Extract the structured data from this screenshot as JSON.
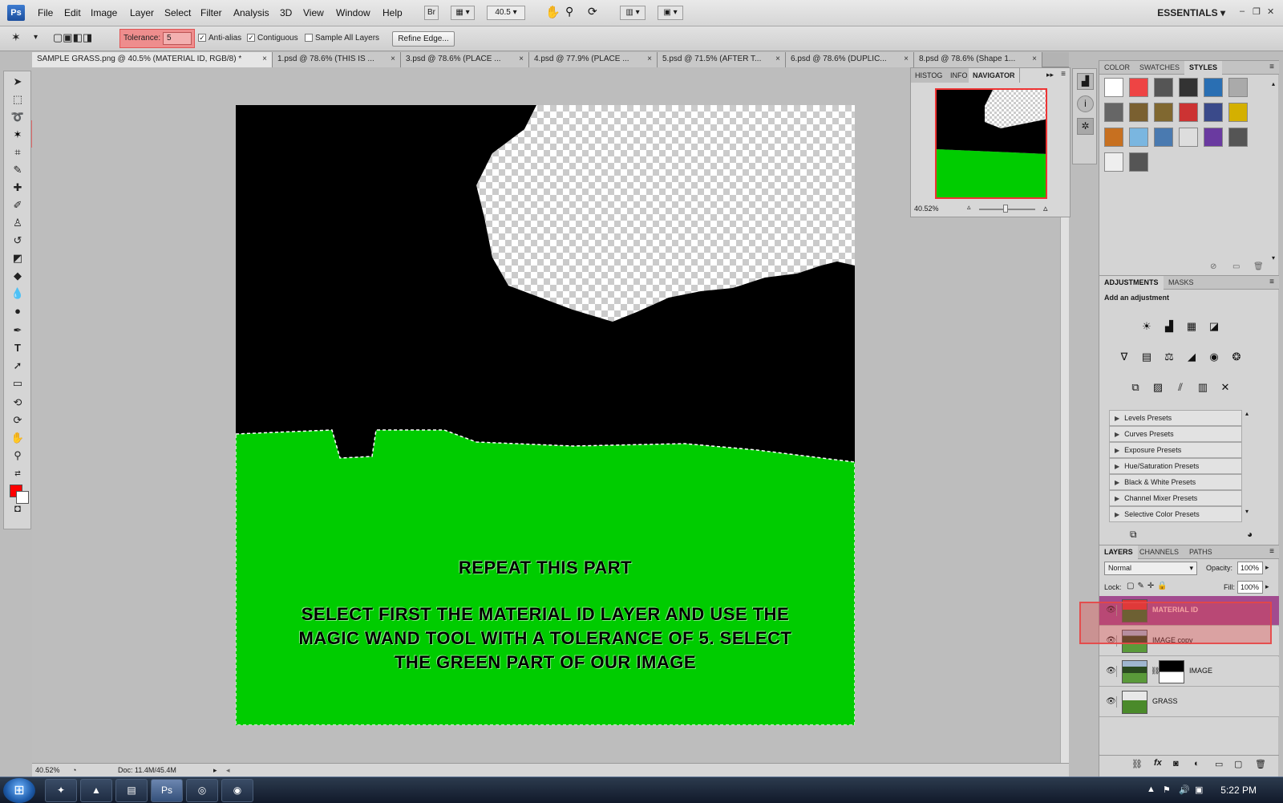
{
  "menubar": {
    "logo": "Ps",
    "items": [
      "File",
      "Edit",
      "Image",
      "Layer",
      "Select",
      "Filter",
      "Analysis",
      "3D",
      "View",
      "Window",
      "Help"
    ],
    "zoom_select": "40.5",
    "workspace": "ESSENTIALS",
    "bridge_label": "Br"
  },
  "options": {
    "tolerance_label": "Tolerance:",
    "tolerance_value": "5",
    "anti_alias_label": "Anti-alias",
    "anti_alias_checked": true,
    "contiguous_label": "Contiguous",
    "contiguous_checked": true,
    "sample_all_label": "Sample All Layers",
    "sample_all_checked": false,
    "refine_edge_label": "Refine Edge..."
  },
  "tabs": [
    {
      "label": "SAMPLE GRASS.png @ 40.5% (MATERIAL ID, RGB/8) *",
      "active": true
    },
    {
      "label": "1.psd @ 78.6% (THIS IS ...",
      "active": false
    },
    {
      "label": "3.psd @ 78.6% (PLACE ...",
      "active": false
    },
    {
      "label": "4.psd @ 77.9% (PLACE ...",
      "active": false
    },
    {
      "label": "5.psd @ 71.5% (AFTER T...",
      "active": false
    },
    {
      "label": "6.psd @ 78.6% (DUPLIC...",
      "active": false
    },
    {
      "label": "8.psd @ 78.6% (Shape 1...",
      "active": false
    }
  ],
  "tab_close": "×",
  "canvas": {
    "heading": "REPEAT THIS PART",
    "instruction_lines": [
      "SELECT FIRST THE MATERIAL ID LAYER AND USE THE",
      "MAGIC WAND TOOL WITH A TOLERANCE OF 5. SELECT",
      "THE GREEN PART OF OUR IMAGE"
    ],
    "grass_color": "#00cc00"
  },
  "status": {
    "zoom": "40.52%",
    "doc_size": "Doc: 11.4M/45.4M"
  },
  "navigator": {
    "tabs": [
      "HISTOG",
      "INFO",
      "NAVIGATOR"
    ],
    "zoom": "40.52%"
  },
  "dock": {
    "color_tabs": [
      "COLOR",
      "SWATCHES",
      "STYLES"
    ],
    "adjust_tabs": [
      "ADJUSTMENTS",
      "MASKS"
    ],
    "add_adjustment": "Add an adjustment",
    "presets": [
      "Levels Presets",
      "Curves Presets",
      "Exposure Presets",
      "Hue/Saturation Presets",
      "Black & White Presets",
      "Channel Mixer Presets",
      "Selective Color Presets"
    ],
    "layers_tabs": [
      "LAYERS",
      "CHANNELS",
      "PATHS"
    ],
    "blend_mode": "Normal",
    "opacity_label": "Opacity:",
    "opacity_value": "100%",
    "lock_label": "Lock:",
    "fill_label": "Fill:",
    "fill_value": "100%",
    "layers": [
      {
        "name": "MATERIAL ID",
        "selected": true
      },
      {
        "name": "IMAGE copy",
        "selected": false
      },
      {
        "name": "IMAGE",
        "selected": false
      },
      {
        "name": "GRASS",
        "selected": false
      }
    ]
  },
  "taskbar": {
    "clock": "5:22 PM"
  },
  "colors": {
    "foreground": "#ff0000",
    "background": "#ffffff",
    "highlight": "#e05555",
    "selected_layer": "#a24b8f"
  }
}
